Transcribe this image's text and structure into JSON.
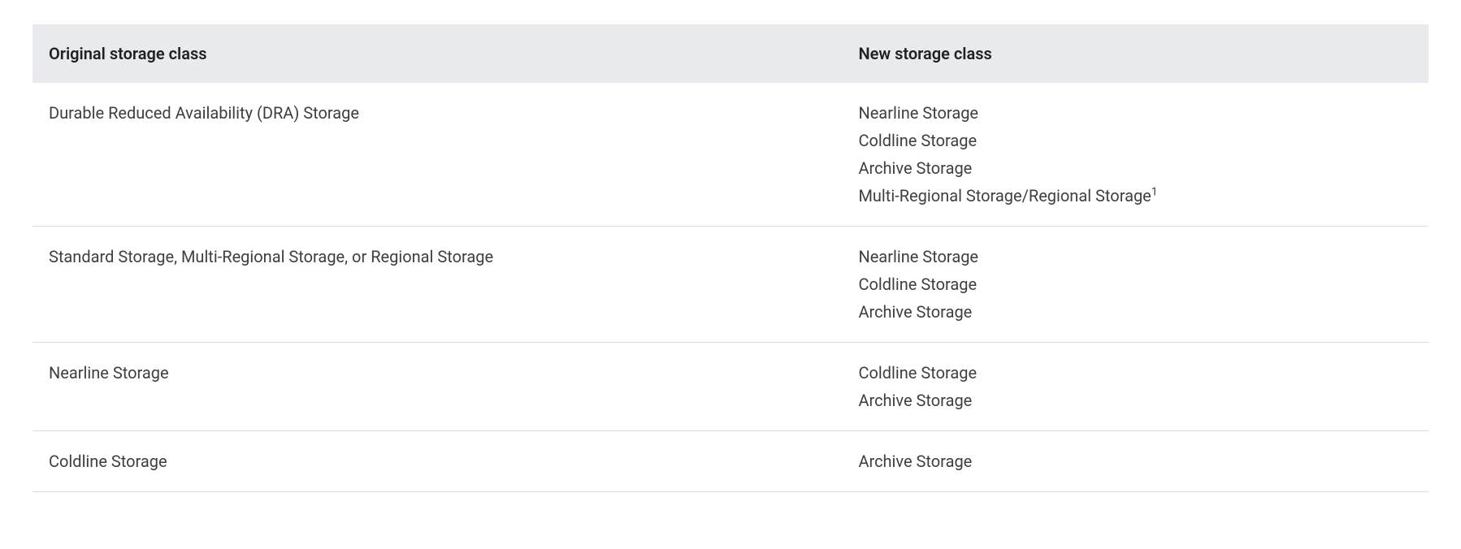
{
  "table": {
    "headers": {
      "col1": "Original storage class",
      "col2": "New storage class"
    },
    "rows": [
      {
        "original": "Durable Reduced Availability (DRA) Storage",
        "newClasses": [
          {
            "text": "Nearline Storage",
            "sup": ""
          },
          {
            "text": "Coldline Storage",
            "sup": ""
          },
          {
            "text": "Archive Storage",
            "sup": ""
          },
          {
            "text": "Multi-Regional Storage/Regional Storage",
            "sup": "1"
          }
        ]
      },
      {
        "original": "Standard Storage, Multi-Regional Storage, or Regional Storage",
        "newClasses": [
          {
            "text": "Nearline Storage",
            "sup": ""
          },
          {
            "text": "Coldline Storage",
            "sup": ""
          },
          {
            "text": "Archive Storage",
            "sup": ""
          }
        ]
      },
      {
        "original": "Nearline Storage",
        "newClasses": [
          {
            "text": "Coldline Storage",
            "sup": ""
          },
          {
            "text": "Archive Storage",
            "sup": ""
          }
        ]
      },
      {
        "original": "Coldline Storage",
        "newClasses": [
          {
            "text": "Archive Storage",
            "sup": ""
          }
        ]
      }
    ]
  }
}
